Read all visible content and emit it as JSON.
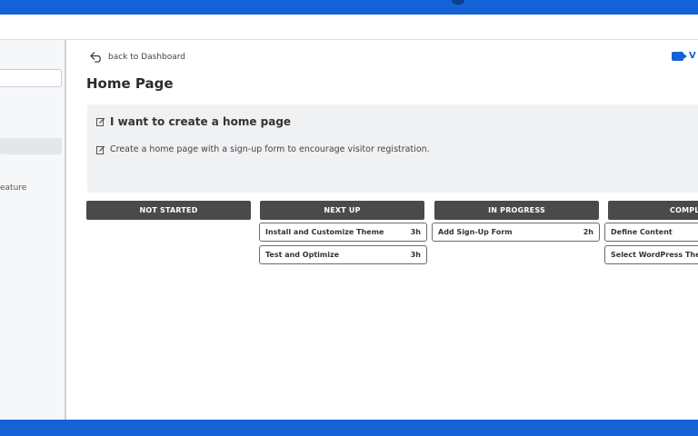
{
  "sidebar": {
    "partial_item": "eature"
  },
  "main": {
    "back_label": "back to Dashboard",
    "video_label": "V",
    "page_title": "Home Page",
    "story": {
      "title": "I want to create a home page",
      "description": "Create a home page with a sign-up form to encourage visitor registration."
    },
    "columns": [
      {
        "label": "NOT STARTED",
        "tasks": []
      },
      {
        "label": "NEXT UP",
        "tasks": [
          {
            "name": "Install and Customize Theme",
            "estimate": "3h"
          },
          {
            "name": "Test and Optimize",
            "estimate": "3h"
          }
        ]
      },
      {
        "label": "IN PROGRESS",
        "tasks": [
          {
            "name": "Add Sign-Up Form",
            "estimate": "2h"
          }
        ]
      },
      {
        "label": "COMPL",
        "tasks": [
          {
            "name": "Define Content",
            "estimate": ""
          },
          {
            "name": "Select WordPress Theme",
            "estimate": ""
          }
        ]
      }
    ]
  },
  "colors": {
    "brand_blue": "#1462d6",
    "column_header_bg": "#4a4a4a",
    "story_card_bg": "#f0f1f3"
  },
  "icons": [
    "back-arrow-icon",
    "video-camera-icon",
    "edit-icon"
  ]
}
